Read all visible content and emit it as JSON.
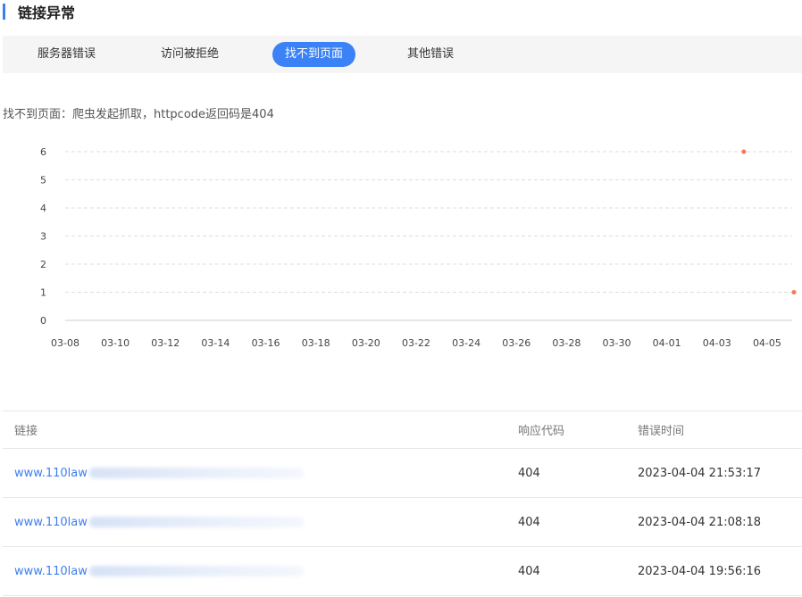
{
  "section": {
    "title": "链接异常"
  },
  "tabs": [
    {
      "label": "服务器错误",
      "active": false
    },
    {
      "label": "访问被拒绝",
      "active": false
    },
    {
      "label": "找不到页面",
      "active": true
    },
    {
      "label": "其他错误",
      "active": false
    }
  ],
  "description": "找不到页面：爬虫发起抓取，httpcode返回码是404",
  "colors": {
    "accent": "#3b82f6",
    "point": "#f47a55",
    "link": "#3d7fef"
  },
  "chart_data": {
    "type": "scatter",
    "x": [
      "03-08",
      "03-09",
      "03-10",
      "03-11",
      "03-12",
      "03-13",
      "03-14",
      "03-15",
      "03-16",
      "03-17",
      "03-18",
      "03-19",
      "03-20",
      "03-21",
      "03-22",
      "03-23",
      "03-24",
      "03-25",
      "03-26",
      "03-27",
      "03-28",
      "03-29",
      "03-30",
      "03-31",
      "04-01",
      "04-02",
      "04-03",
      "04-04",
      "04-05",
      "04-06"
    ],
    "x_tick_labels": [
      "03-08",
      "03-10",
      "03-12",
      "03-14",
      "03-16",
      "03-18",
      "03-20",
      "03-22",
      "03-24",
      "03-26",
      "03-28",
      "03-30",
      "04-01",
      "04-03",
      "04-05"
    ],
    "series": [
      {
        "values": [
          null,
          null,
          null,
          null,
          null,
          null,
          null,
          null,
          null,
          null,
          null,
          null,
          null,
          null,
          null,
          null,
          null,
          null,
          null,
          null,
          null,
          null,
          null,
          null,
          null,
          null,
          null,
          6,
          null,
          1
        ]
      }
    ],
    "y_ticks": [
      "0",
      "1",
      "2",
      "3",
      "4",
      "5",
      "6"
    ],
    "ylim": [
      0,
      6
    ],
    "grid": true,
    "title": "",
    "xlabel": "",
    "ylabel": ""
  },
  "table": {
    "headers": {
      "link": "链接",
      "code": "响应代码",
      "time": "错误时间"
    },
    "rows": [
      {
        "link": "www.110law",
        "code": "404",
        "time": "2023-04-04 21:53:17"
      },
      {
        "link": "www.110law",
        "code": "404",
        "time": "2023-04-04 21:08:18"
      },
      {
        "link": "www.110law",
        "code": "404",
        "time": "2023-04-04 19:56:16"
      }
    ]
  }
}
